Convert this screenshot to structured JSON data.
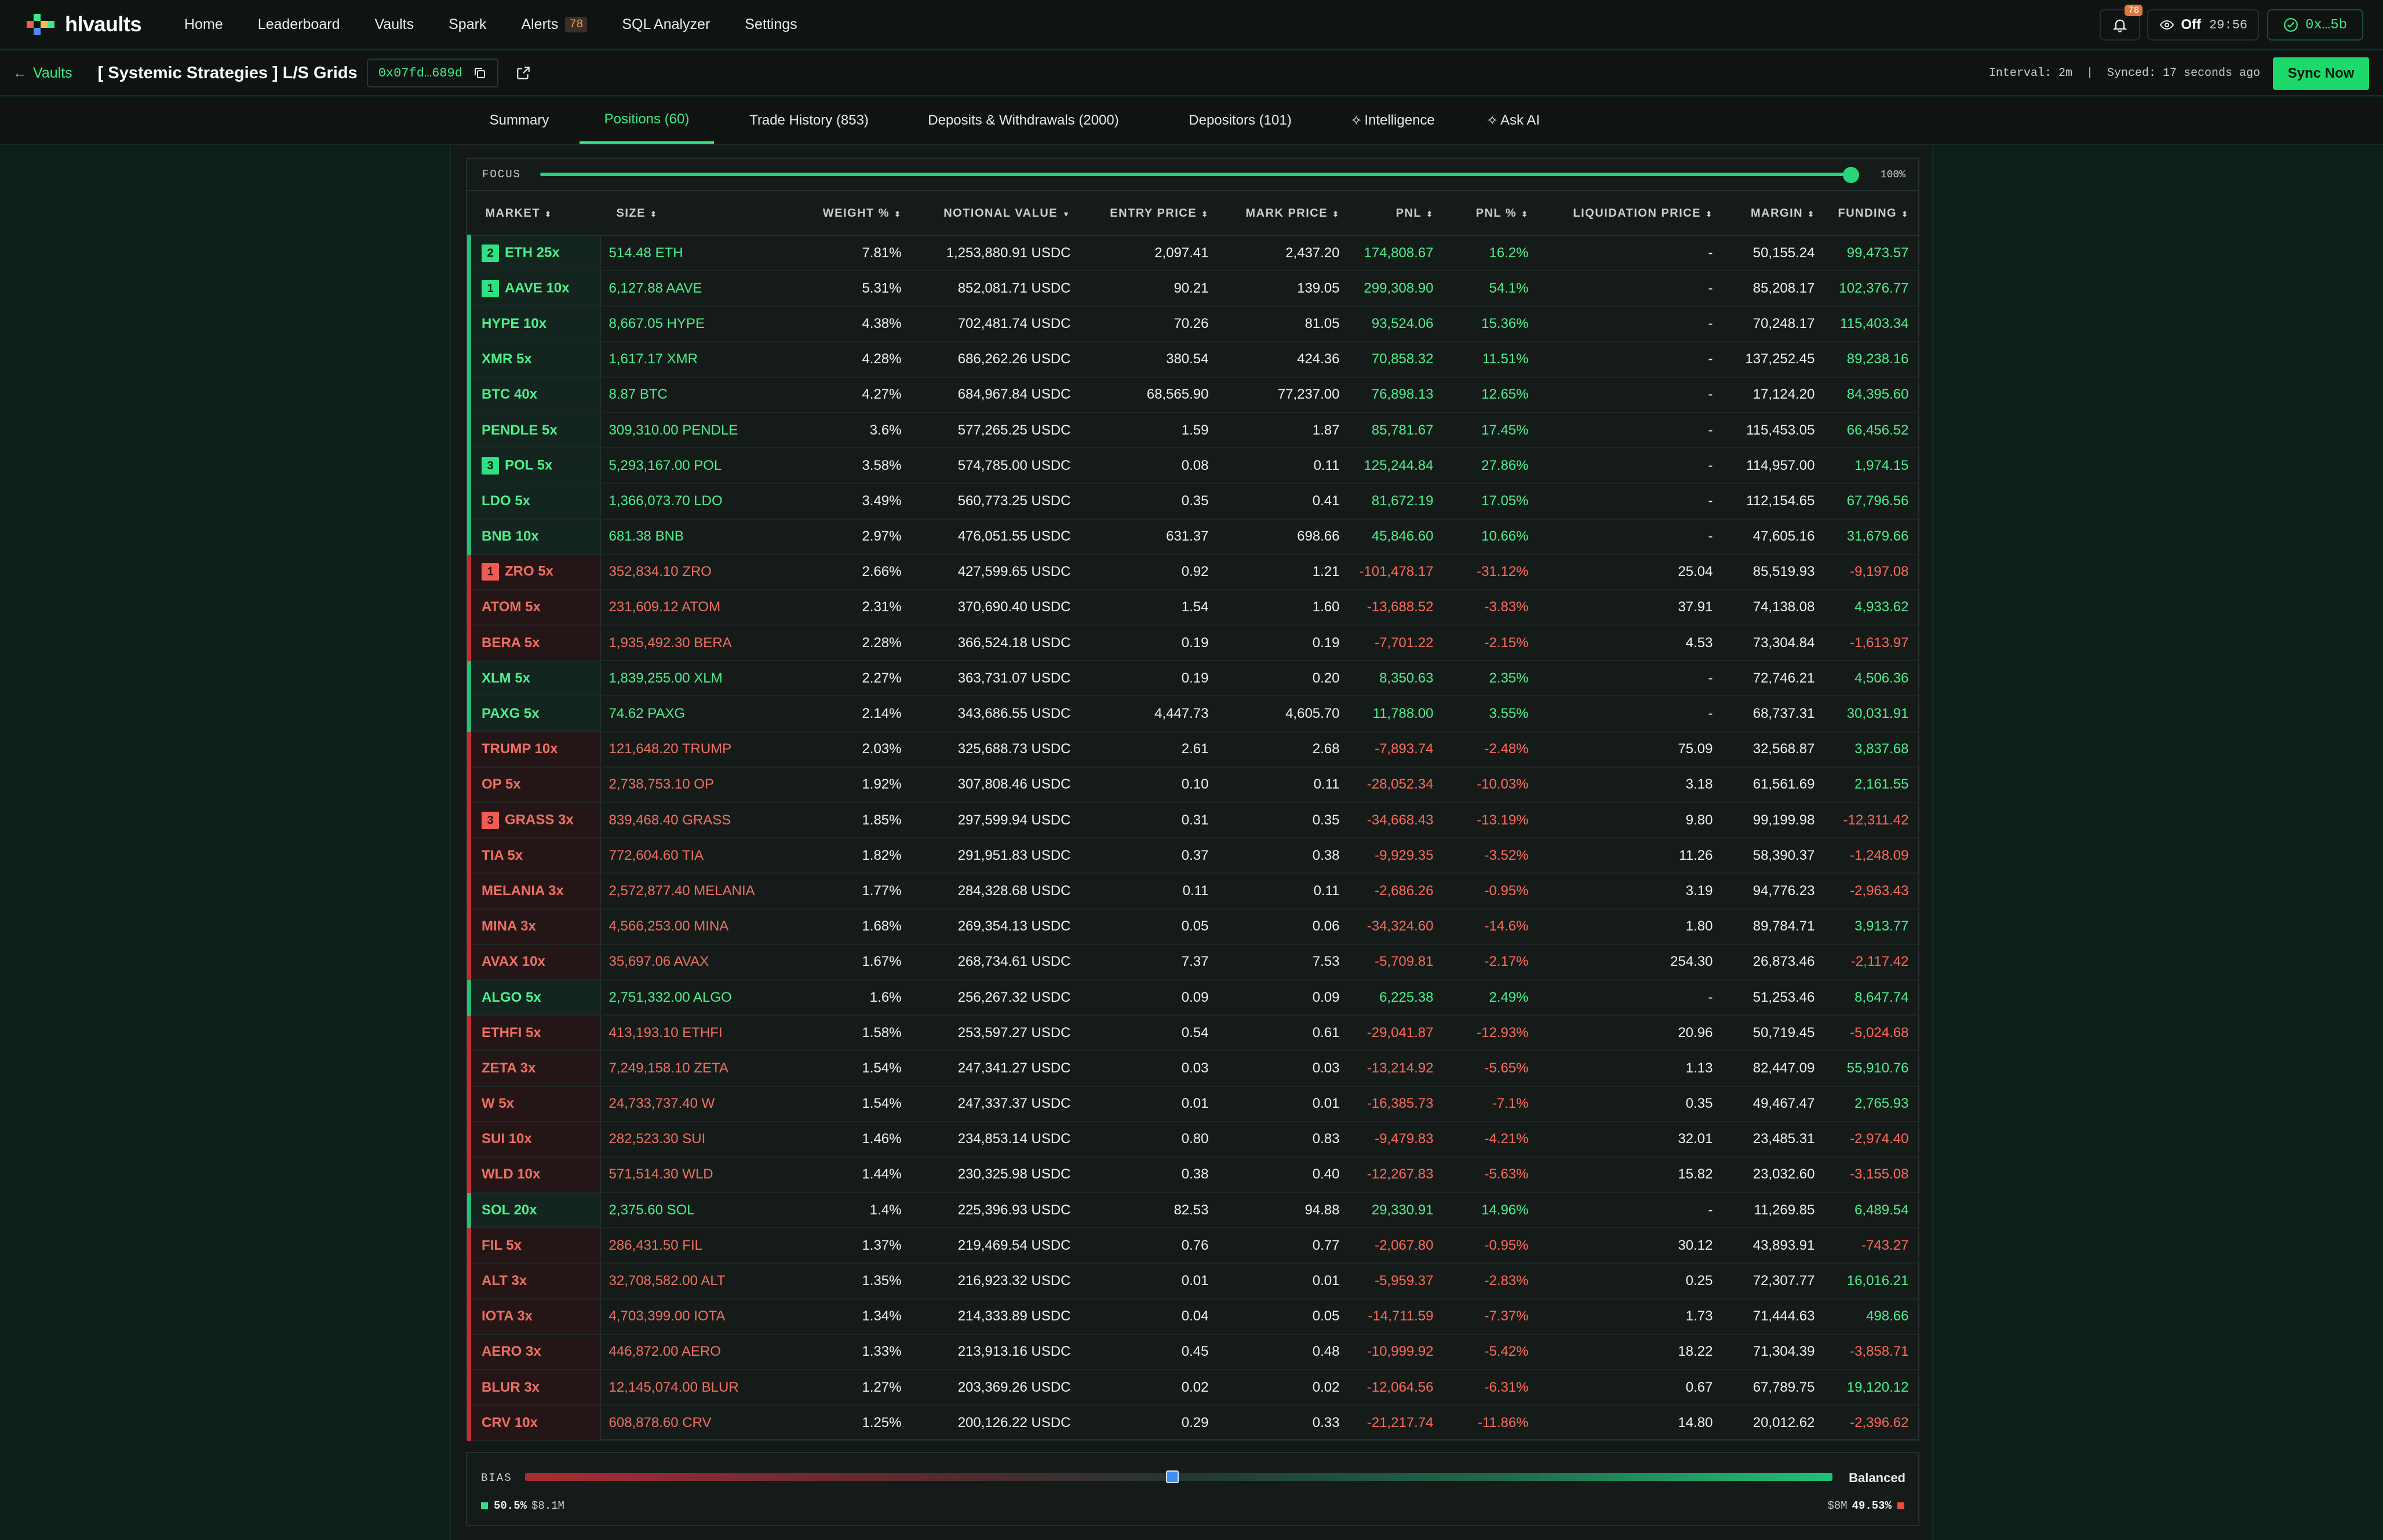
{
  "app": {
    "logo_text": "hlvaults"
  },
  "nav": [
    {
      "label": "Home"
    },
    {
      "label": "Leaderboard"
    },
    {
      "label": "Vaults"
    },
    {
      "label": "Spark"
    },
    {
      "label": "Alerts",
      "badge": "78"
    },
    {
      "label": "SQL Analyzer"
    },
    {
      "label": "Settings"
    }
  ],
  "top_right": {
    "bell_badge": "78",
    "off_label": "Off",
    "timer": "29:56",
    "wallet": "0x…5b"
  },
  "subbar": {
    "back_label": "Vaults",
    "vault_title": "[ Systemic Strategies ] L/S Grids",
    "address": "0x07fd…689d",
    "sync_info": "Interval: 2m  |  Synced: 17 seconds ago",
    "sync_button": "Sync Now"
  },
  "tabs": [
    {
      "label": "Summary",
      "active": false
    },
    {
      "label": "Positions (60)",
      "active": true
    },
    {
      "label": "Trade History (853)",
      "active": false
    },
    {
      "label": "Deposits & Withdrawals (2000)",
      "active": false
    },
    {
      "label": "Depositors (101)",
      "active": false
    },
    {
      "label": "Intelligence",
      "active": false
    },
    {
      "label": "Ask AI",
      "active": false
    }
  ],
  "focus": {
    "label": "FOCUS",
    "value": "100%",
    "level": 1.0
  },
  "table": {
    "headers": [
      "MARKET",
      "SIZE",
      "WEIGHT %",
      "NOTIONAL VALUE",
      "ENTRY PRICE",
      "MARK PRICE",
      "PNL",
      "PNL %",
      "LIQUIDATION PRICE",
      "MARGIN",
      "FUNDING"
    ],
    "header_arrows": [
      "⬍",
      "⬍",
      "⬍",
      "▼",
      "⬍",
      "⬍",
      "⬍",
      "⬍",
      "⬍",
      "⬍",
      "⬍"
    ],
    "rows": [
      {
        "side": "long",
        "rank": "2",
        "market": "ETH 25x",
        "size": "514.48 ETH",
        "weight": "7.81%",
        "notional": "1,253,880.91 USDC",
        "entry": "2,097.41",
        "mark": "2,437.20",
        "pnl": "174,808.67",
        "pnl_pct": "16.2%",
        "liq": "-",
        "margin": "50,155.24",
        "funding": "99,473.57"
      },
      {
        "side": "long",
        "rank": "1",
        "market": "AAVE 10x",
        "size": "6,127.88 AAVE",
        "weight": "5.31%",
        "notional": "852,081.71 USDC",
        "entry": "90.21",
        "mark": "139.05",
        "pnl": "299,308.90",
        "pnl_pct": "54.1%",
        "liq": "-",
        "margin": "85,208.17",
        "funding": "102,376.77"
      },
      {
        "side": "long",
        "rank": "",
        "market": "HYPE 10x",
        "size": "8,667.05 HYPE",
        "weight": "4.38%",
        "notional": "702,481.74 USDC",
        "entry": "70.26",
        "mark": "81.05",
        "pnl": "93,524.06",
        "pnl_pct": "15.36%",
        "liq": "-",
        "margin": "70,248.17",
        "funding": "115,403.34"
      },
      {
        "side": "long",
        "rank": "",
        "market": "XMR 5x",
        "size": "1,617.17 XMR",
        "weight": "4.28%",
        "notional": "686,262.26 USDC",
        "entry": "380.54",
        "mark": "424.36",
        "pnl": "70,858.32",
        "pnl_pct": "11.51%",
        "liq": "-",
        "margin": "137,252.45",
        "funding": "89,238.16"
      },
      {
        "side": "long",
        "rank": "",
        "market": "BTC 40x",
        "size": "8.87 BTC",
        "weight": "4.27%",
        "notional": "684,967.84 USDC",
        "entry": "68,565.90",
        "mark": "77,237.00",
        "pnl": "76,898.13",
        "pnl_pct": "12.65%",
        "liq": "-",
        "margin": "17,124.20",
        "funding": "84,395.60"
      },
      {
        "side": "long",
        "rank": "",
        "market": "PENDLE 5x",
        "size": "309,310.00 PENDLE",
        "weight": "3.6%",
        "notional": "577,265.25 USDC",
        "entry": "1.59",
        "mark": "1.87",
        "pnl": "85,781.67",
        "pnl_pct": "17.45%",
        "liq": "-",
        "margin": "115,453.05",
        "funding": "66,456.52"
      },
      {
        "side": "long",
        "rank": "3",
        "market": "POL 5x",
        "size": "5,293,167.00 POL",
        "weight": "3.58%",
        "notional": "574,785.00 USDC",
        "entry": "0.08",
        "mark": "0.11",
        "pnl": "125,244.84",
        "pnl_pct": "27.86%",
        "liq": "-",
        "margin": "114,957.00",
        "funding": "1,974.15"
      },
      {
        "side": "long",
        "rank": "",
        "market": "LDO 5x",
        "size": "1,366,073.70 LDO",
        "weight": "3.49%",
        "notional": "560,773.25 USDC",
        "entry": "0.35",
        "mark": "0.41",
        "pnl": "81,672.19",
        "pnl_pct": "17.05%",
        "liq": "-",
        "margin": "112,154.65",
        "funding": "67,796.56"
      },
      {
        "side": "long",
        "rank": "",
        "market": "BNB 10x",
        "size": "681.38 BNB",
        "weight": "2.97%",
        "notional": "476,051.55 USDC",
        "entry": "631.37",
        "mark": "698.66",
        "pnl": "45,846.60",
        "pnl_pct": "10.66%",
        "liq": "-",
        "margin": "47,605.16",
        "funding": "31,679.66"
      },
      {
        "side": "short",
        "rank": "1",
        "market": "ZRO 5x",
        "size": "352,834.10 ZRO",
        "weight": "2.66%",
        "notional": "427,599.65 USDC",
        "entry": "0.92",
        "mark": "1.21",
        "pnl": "-101,478.17",
        "pnl_pct": "-31.12%",
        "liq": "25.04",
        "margin": "85,519.93",
        "funding": "-9,197.08"
      },
      {
        "side": "short",
        "rank": "",
        "market": "ATOM 5x",
        "size": "231,609.12 ATOM",
        "weight": "2.31%",
        "notional": "370,690.40 USDC",
        "entry": "1.54",
        "mark": "1.60",
        "pnl": "-13,688.52",
        "pnl_pct": "-3.83%",
        "liq": "37.91",
        "margin": "74,138.08",
        "funding": "4,933.62"
      },
      {
        "side": "short",
        "rank": "",
        "market": "BERA 5x",
        "size": "1,935,492.30 BERA",
        "weight": "2.28%",
        "notional": "366,524.18 USDC",
        "entry": "0.19",
        "mark": "0.19",
        "pnl": "-7,701.22",
        "pnl_pct": "-2.15%",
        "liq": "4.53",
        "margin": "73,304.84",
        "funding": "-1,613.97"
      },
      {
        "side": "long",
        "rank": "",
        "market": "XLM 5x",
        "size": "1,839,255.00 XLM",
        "weight": "2.27%",
        "notional": "363,731.07 USDC",
        "entry": "0.19",
        "mark": "0.20",
        "pnl": "8,350.63",
        "pnl_pct": "2.35%",
        "liq": "-",
        "margin": "72,746.21",
        "funding": "4,506.36"
      },
      {
        "side": "long",
        "rank": "",
        "market": "PAXG 5x",
        "size": "74.62 PAXG",
        "weight": "2.14%",
        "notional": "343,686.55 USDC",
        "entry": "4,447.73",
        "mark": "4,605.70",
        "pnl": "11,788.00",
        "pnl_pct": "3.55%",
        "liq": "-",
        "margin": "68,737.31",
        "funding": "30,031.91"
      },
      {
        "side": "short",
        "rank": "",
        "market": "TRUMP 10x",
        "size": "121,648.20 TRUMP",
        "weight": "2.03%",
        "notional": "325,688.73 USDC",
        "entry": "2.61",
        "mark": "2.68",
        "pnl": "-7,893.74",
        "pnl_pct": "-2.48%",
        "liq": "75.09",
        "margin": "32,568.87",
        "funding": "3,837.68"
      },
      {
        "side": "short",
        "rank": "",
        "market": "OP 5x",
        "size": "2,738,753.10 OP",
        "weight": "1.92%",
        "notional": "307,808.46 USDC",
        "entry": "0.10",
        "mark": "0.11",
        "pnl": "-28,052.34",
        "pnl_pct": "-10.03%",
        "liq": "3.18",
        "margin": "61,561.69",
        "funding": "2,161.55"
      },
      {
        "side": "short",
        "rank": "3",
        "market": "GRASS 3x",
        "size": "839,468.40 GRASS",
        "weight": "1.85%",
        "notional": "297,599.94 USDC",
        "entry": "0.31",
        "mark": "0.35",
        "pnl": "-34,668.43",
        "pnl_pct": "-13.19%",
        "liq": "9.80",
        "margin": "99,199.98",
        "funding": "-12,311.42"
      },
      {
        "side": "short",
        "rank": "",
        "market": "TIA 5x",
        "size": "772,604.60 TIA",
        "weight": "1.82%",
        "notional": "291,951.83 USDC",
        "entry": "0.37",
        "mark": "0.38",
        "pnl": "-9,929.35",
        "pnl_pct": "-3.52%",
        "liq": "11.26",
        "margin": "58,390.37",
        "funding": "-1,248.09"
      },
      {
        "side": "short",
        "rank": "",
        "market": "MELANIA 3x",
        "size": "2,572,877.40 MELANIA",
        "weight": "1.77%",
        "notional": "284,328.68 USDC",
        "entry": "0.11",
        "mark": "0.11",
        "pnl": "-2,686.26",
        "pnl_pct": "-0.95%",
        "liq": "3.19",
        "margin": "94,776.23",
        "funding": "-2,963.43"
      },
      {
        "side": "short",
        "rank": "",
        "market": "MINA 3x",
        "size": "4,566,253.00 MINA",
        "weight": "1.68%",
        "notional": "269,354.13 USDC",
        "entry": "0.05",
        "mark": "0.06",
        "pnl": "-34,324.60",
        "pnl_pct": "-14.6%",
        "liq": "1.80",
        "margin": "89,784.71",
        "funding": "3,913.77"
      },
      {
        "side": "short",
        "rank": "",
        "market": "AVAX 10x",
        "size": "35,697.06 AVAX",
        "weight": "1.67%",
        "notional": "268,734.61 USDC",
        "entry": "7.37",
        "mark": "7.53",
        "pnl": "-5,709.81",
        "pnl_pct": "-2.17%",
        "liq": "254.30",
        "margin": "26,873.46",
        "funding": "-2,117.42"
      },
      {
        "side": "long",
        "rank": "",
        "market": "ALGO 5x",
        "size": "2,751,332.00 ALGO",
        "weight": "1.6%",
        "notional": "256,267.32 USDC",
        "entry": "0.09",
        "mark": "0.09",
        "pnl": "6,225.38",
        "pnl_pct": "2.49%",
        "liq": "-",
        "margin": "51,253.46",
        "funding": "8,647.74"
      },
      {
        "side": "short",
        "rank": "",
        "market": "ETHFI 5x",
        "size": "413,193.10 ETHFI",
        "weight": "1.58%",
        "notional": "253,597.27 USDC",
        "entry": "0.54",
        "mark": "0.61",
        "pnl": "-29,041.87",
        "pnl_pct": "-12.93%",
        "liq": "20.96",
        "margin": "50,719.45",
        "funding": "-5,024.68"
      },
      {
        "side": "short",
        "rank": "",
        "market": "ZETA 3x",
        "size": "7,249,158.10 ZETA",
        "weight": "1.54%",
        "notional": "247,341.27 USDC",
        "entry": "0.03",
        "mark": "0.03",
        "pnl": "-13,214.92",
        "pnl_pct": "-5.65%",
        "liq": "1.13",
        "margin": "82,447.09",
        "funding": "55,910.76"
      },
      {
        "side": "short",
        "rank": "",
        "market": "W 5x",
        "size": "24,733,737.40 W",
        "weight": "1.54%",
        "notional": "247,337.37 USDC",
        "entry": "0.01",
        "mark": "0.01",
        "pnl": "-16,385.73",
        "pnl_pct": "-7.1%",
        "liq": "0.35",
        "margin": "49,467.47",
        "funding": "2,765.93"
      },
      {
        "side": "short",
        "rank": "",
        "market": "SUI 10x",
        "size": "282,523.30 SUI",
        "weight": "1.46%",
        "notional": "234,853.14 USDC",
        "entry": "0.80",
        "mark": "0.83",
        "pnl": "-9,479.83",
        "pnl_pct": "-4.21%",
        "liq": "32.01",
        "margin": "23,485.31",
        "funding": "-2,974.40"
      },
      {
        "side": "short",
        "rank": "",
        "market": "WLD 10x",
        "size": "571,514.30 WLD",
        "weight": "1.44%",
        "notional": "230,325.98 USDC",
        "entry": "0.38",
        "mark": "0.40",
        "pnl": "-12,267.83",
        "pnl_pct": "-5.63%",
        "liq": "15.82",
        "margin": "23,032.60",
        "funding": "-3,155.08"
      },
      {
        "side": "long",
        "rank": "",
        "market": "SOL 20x",
        "size": "2,375.60 SOL",
        "weight": "1.4%",
        "notional": "225,396.93 USDC",
        "entry": "82.53",
        "mark": "94.88",
        "pnl": "29,330.91",
        "pnl_pct": "14.96%",
        "liq": "-",
        "margin": "11,269.85",
        "funding": "6,489.54"
      },
      {
        "side": "short",
        "rank": "",
        "market": "FIL 5x",
        "size": "286,431.50 FIL",
        "weight": "1.37%",
        "notional": "219,469.54 USDC",
        "entry": "0.76",
        "mark": "0.77",
        "pnl": "-2,067.80",
        "pnl_pct": "-0.95%",
        "liq": "30.12",
        "margin": "43,893.91",
        "funding": "-743.27"
      },
      {
        "side": "short",
        "rank": "",
        "market": "ALT 3x",
        "size": "32,708,582.00 ALT",
        "weight": "1.35%",
        "notional": "216,923.32 USDC",
        "entry": "0.01",
        "mark": "0.01",
        "pnl": "-5,959.37",
        "pnl_pct": "-2.83%",
        "liq": "0.25",
        "margin": "72,307.77",
        "funding": "16,016.21"
      },
      {
        "side": "short",
        "rank": "",
        "market": "IOTA 3x",
        "size": "4,703,399.00 IOTA",
        "weight": "1.34%",
        "notional": "214,333.89 USDC",
        "entry": "0.04",
        "mark": "0.05",
        "pnl": "-14,711.59",
        "pnl_pct": "-7.37%",
        "liq": "1.73",
        "margin": "71,444.63",
        "funding": "498.66"
      },
      {
        "side": "short",
        "rank": "",
        "market": "AERO 3x",
        "size": "446,872.00 AERO",
        "weight": "1.33%",
        "notional": "213,913.16 USDC",
        "entry": "0.45",
        "mark": "0.48",
        "pnl": "-10,999.92",
        "pnl_pct": "-5.42%",
        "liq": "18.22",
        "margin": "71,304.39",
        "funding": "-3,858.71"
      },
      {
        "side": "short",
        "rank": "",
        "market": "BLUR 3x",
        "size": "12,145,074.00 BLUR",
        "weight": "1.27%",
        "notional": "203,369.26 USDC",
        "entry": "0.02",
        "mark": "0.02",
        "pnl": "-12,064.56",
        "pnl_pct": "-6.31%",
        "liq": "0.67",
        "margin": "67,789.75",
        "funding": "19,120.12"
      },
      {
        "side": "short",
        "rank": "",
        "market": "CRV 10x",
        "size": "608,878.60 CRV",
        "weight": "1.25%",
        "notional": "200,126.22 USDC",
        "entry": "0.29",
        "mark": "0.33",
        "pnl": "-21,217.74",
        "pnl_pct": "-11.86%",
        "liq": "14.80",
        "margin": "20,012.62",
        "funding": "-2,396.62"
      }
    ]
  },
  "bias": {
    "label": "BIAS",
    "value_label": "Balanced",
    "level": 0.505,
    "long_pct": "50.5%",
    "long_value": "$8.1M",
    "short_value": "$8M",
    "short_pct": "49.53%"
  },
  "colors": {
    "accent": "#3ee98a",
    "long": "#4cf08e",
    "short": "#ff6a5a",
    "background": "#0c1f1b"
  }
}
